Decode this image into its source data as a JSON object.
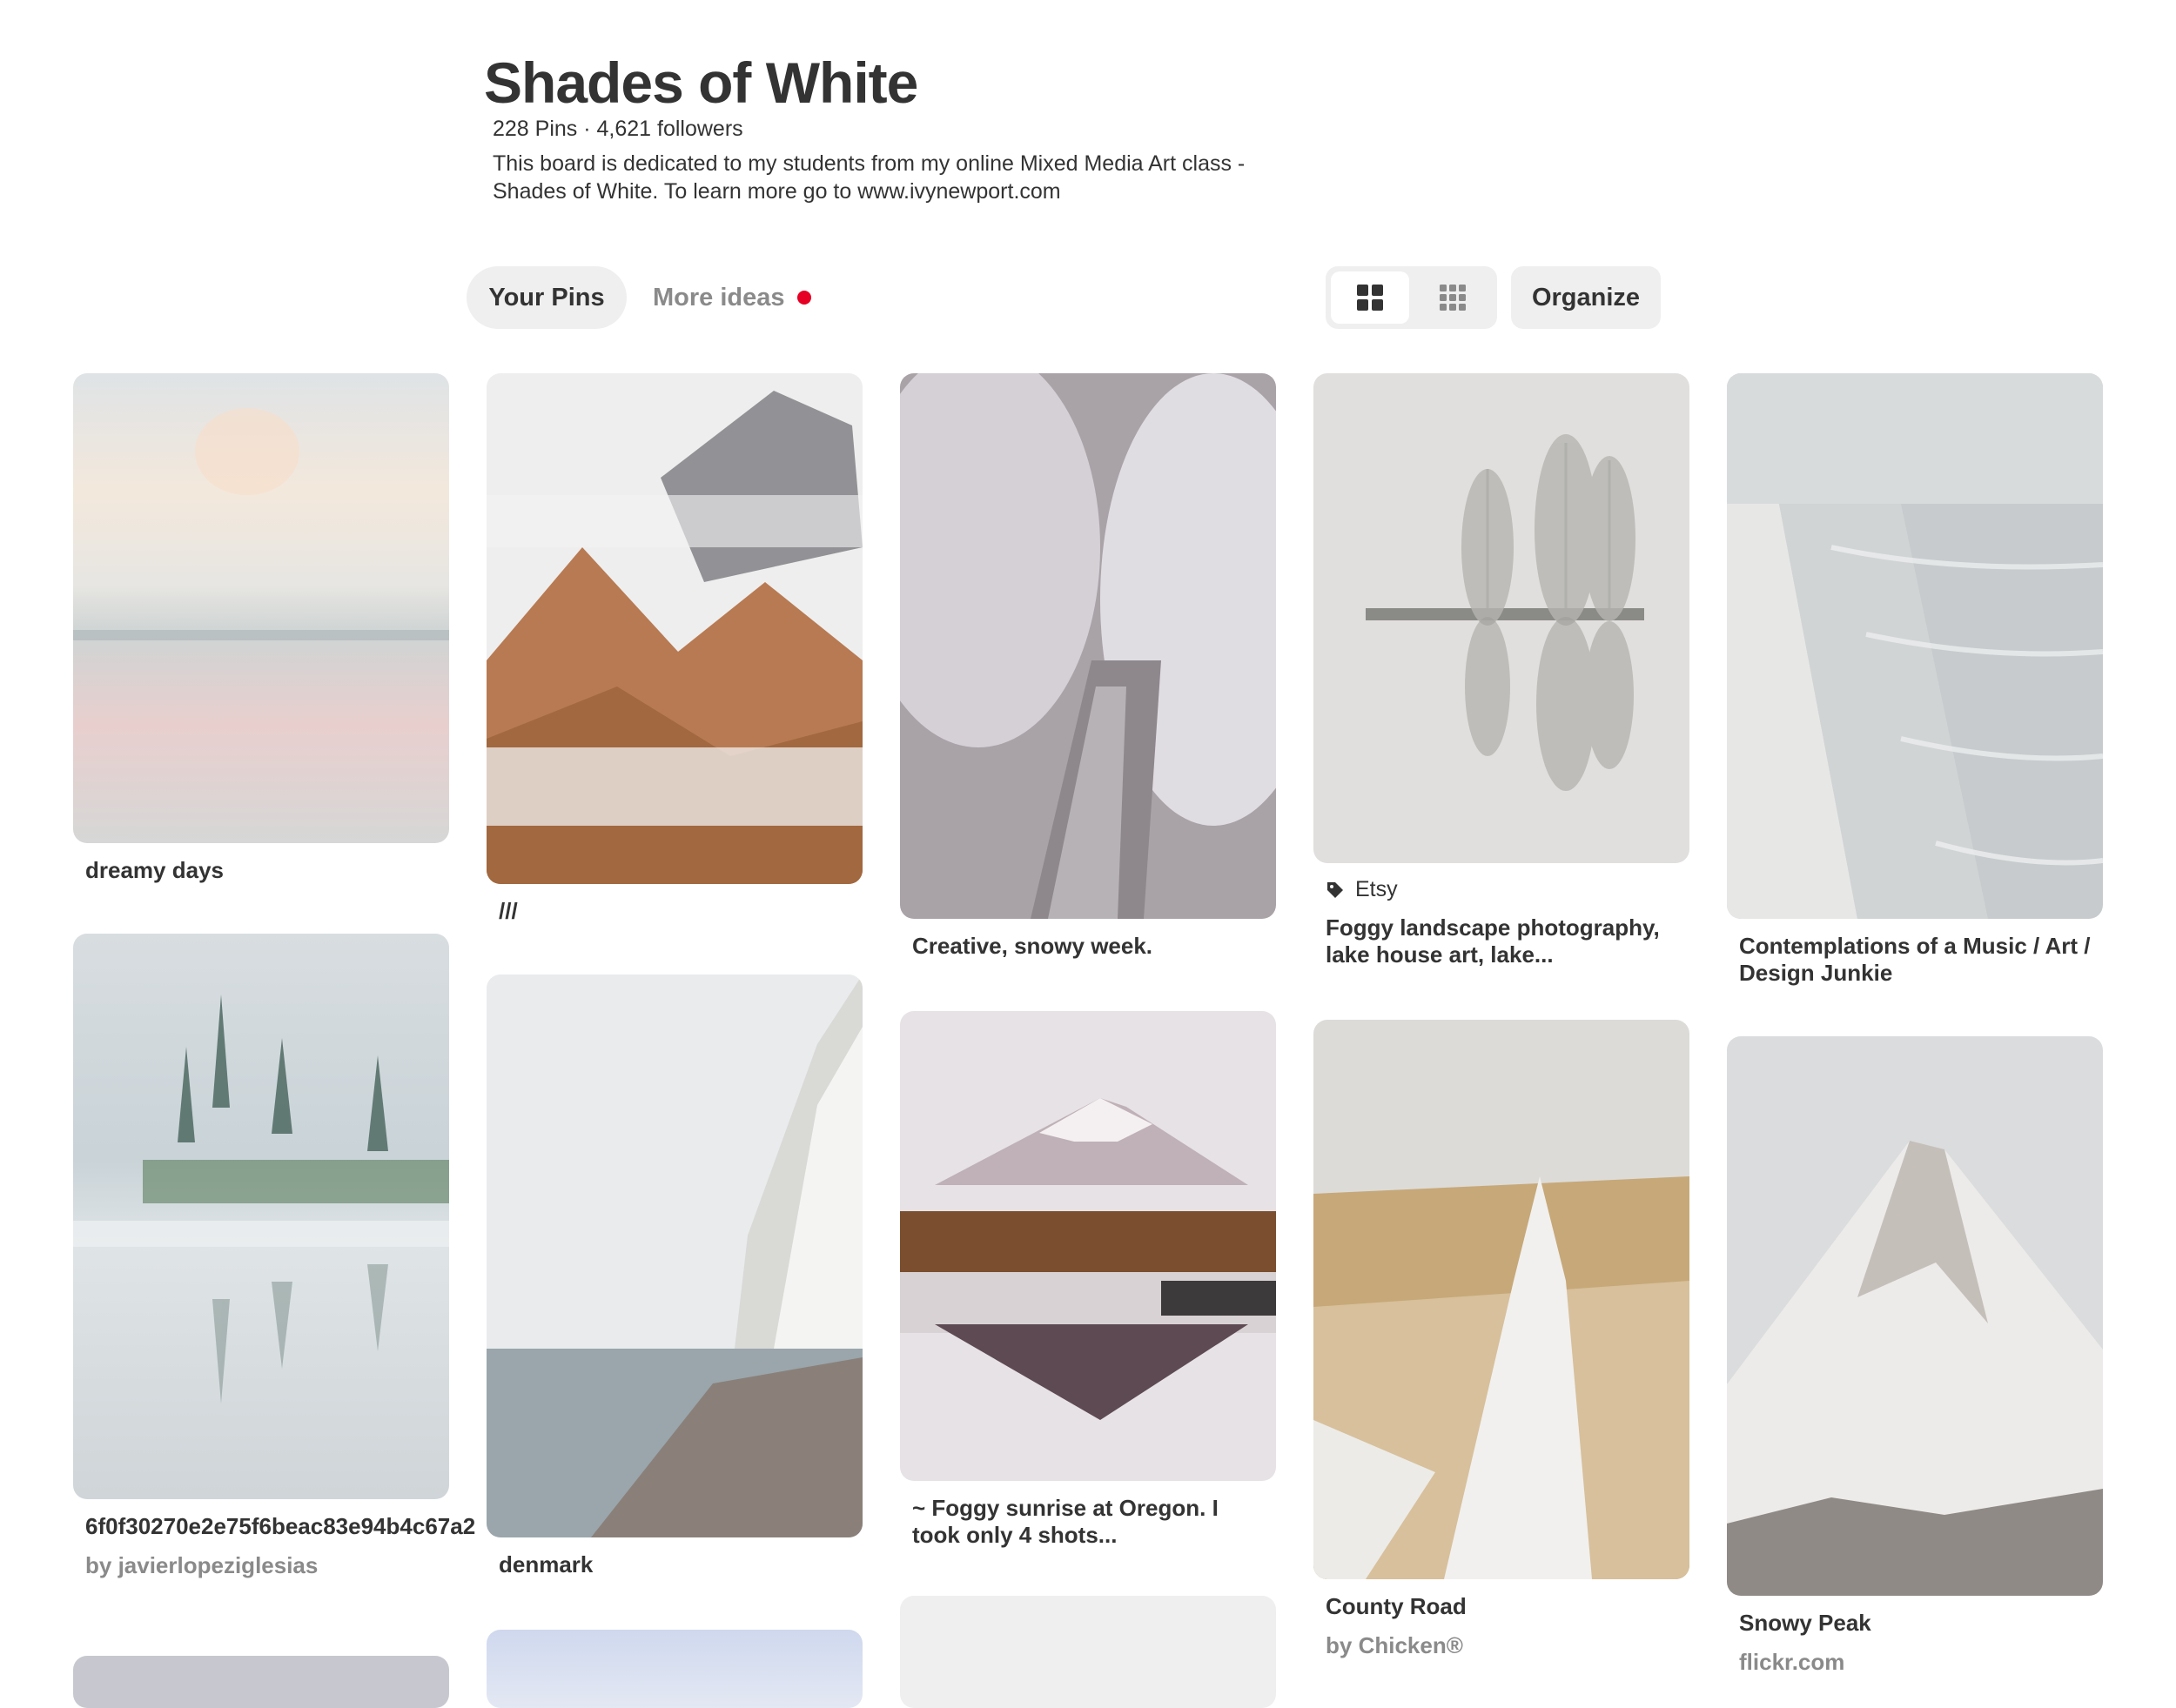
{
  "board": {
    "title": "Shades of White",
    "stats": "228 Pins · 4,621 followers",
    "description": "This board is dedicated to my students from my online Mixed Media Art class - Shades of White. To learn more go to www.ivynewport.com"
  },
  "tabs": {
    "your_pins": "Your Pins",
    "more_ideas": "More ideas"
  },
  "toolbar": {
    "organize": "Organize"
  },
  "pins": [
    {
      "title": "dreamy days"
    },
    {
      "title": "///"
    },
    {
      "title": "Creative, snowy week."
    },
    {
      "source": "Etsy",
      "title": "Foggy landscape photography, lake house art, lake..."
    },
    {
      "title": "Contemplations of a Music / Art / Design Junkie"
    },
    {
      "title": "6f0f30270e2e75f6beac83e94b4c67a2",
      "subtitle": "by javierlopeziglesias"
    },
    {
      "title": "denmark"
    },
    {
      "title": "~ Foggy sunrise at Oregon. I took only 4 shots..."
    },
    {
      "title": "County Road",
      "subtitle": "by Chicken®"
    },
    {
      "title": "Snowy Peak",
      "subtitle": "flickr.com"
    }
  ],
  "colors": {
    "notification_dot": "#e60023",
    "tab_bg": "#efefef",
    "text": "#333333",
    "muted": "#8a8a8a"
  },
  "icons": {
    "grid_default": "grid-large-icon",
    "grid_compact": "grid-small-icon",
    "source_tag": "tag-icon"
  }
}
